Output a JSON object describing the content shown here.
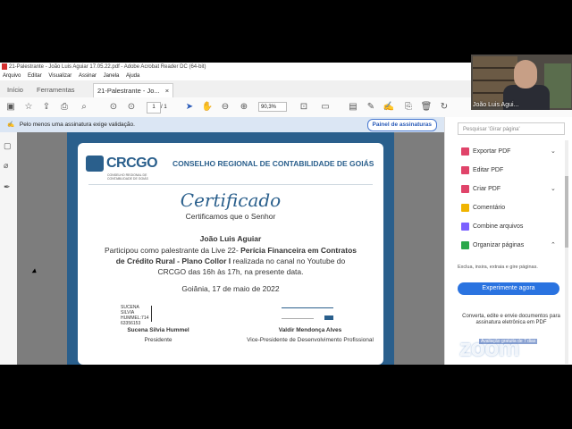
{
  "window": {
    "title": "21-Palestrante - João Luis Aguiar 17.05.22.pdf - Adobe Acrobat Reader DC (64-bit)"
  },
  "menu": [
    "Arquivo",
    "Editar",
    "Visualizar",
    "Assinar",
    "Janela",
    "Ajuda"
  ],
  "tabs": {
    "home": "Início",
    "tools": "Ferramentas",
    "doc": "21-Palestrante - Jo...",
    "doc_close": "×"
  },
  "toolbar": {
    "page_current": "1",
    "page_sep": "/",
    "page_total": "1",
    "zoom": "90,3%"
  },
  "signature_bar": {
    "message": "Pelo menos uma assinatura exige validação.",
    "button": "Painel de assinaturas"
  },
  "certificate": {
    "logo": "CRCGO",
    "logo_sub": "CONSELHO REGIONAL DE CONTABILIDADE DE GOIÁS",
    "org_name": "CONSELHO REGIONAL DE CONTABILIDADE DE GOIÁS",
    "title": "Certificado",
    "subtitle": "Certificamos que o Senhor",
    "name": "João Luis Aguiar",
    "body_1": "Participou como palestrante da Live 22-",
    "body_bold": "Perícia Financeira em Contratos de Crédito Rural - Plano Collor I",
    "body_2": "realizada no canal no Youtube do CRCGO das 16h às 17h, na presente data.",
    "date": "Goiânia, 17 de maio de 2022",
    "sig1_lines": [
      "SUCENA",
      "SILVIA",
      "HUMMEL:714",
      "63356153"
    ],
    "sig1_name": "Sucena Silvia Hummel",
    "sig1_role": "Presidente",
    "sig2_name": "Valdir Mendonça Alves",
    "sig2_role": "Vice-Presidente de Desenvolvimento Profissional"
  },
  "right_panel": {
    "search_placeholder": "Pesquisar 'Girar página'",
    "tools": [
      {
        "label": "Exportar PDF",
        "color": "#e0446a"
      },
      {
        "label": "Editar PDF",
        "color": "#e0446a"
      },
      {
        "label": "Criar PDF",
        "color": "#e0446a"
      },
      {
        "label": "Comentário",
        "color": "#f0b400"
      },
      {
        "label": "Combine arquivos",
        "color": "#7b61ff"
      },
      {
        "label": "Organizar páginas",
        "color": "#2aa84a"
      }
    ],
    "organize_desc": "Exclua, insira, extraia e gire páginas.",
    "try_button": "Experimente agora",
    "convert_text": "Converta, edite e envie documentos para assinatura eletrônica em PDF",
    "watermark": "zoom",
    "watermark_sub": "Avaliação gratuita de 7 dias"
  },
  "video": {
    "participant": "João Luis Agui..."
  }
}
